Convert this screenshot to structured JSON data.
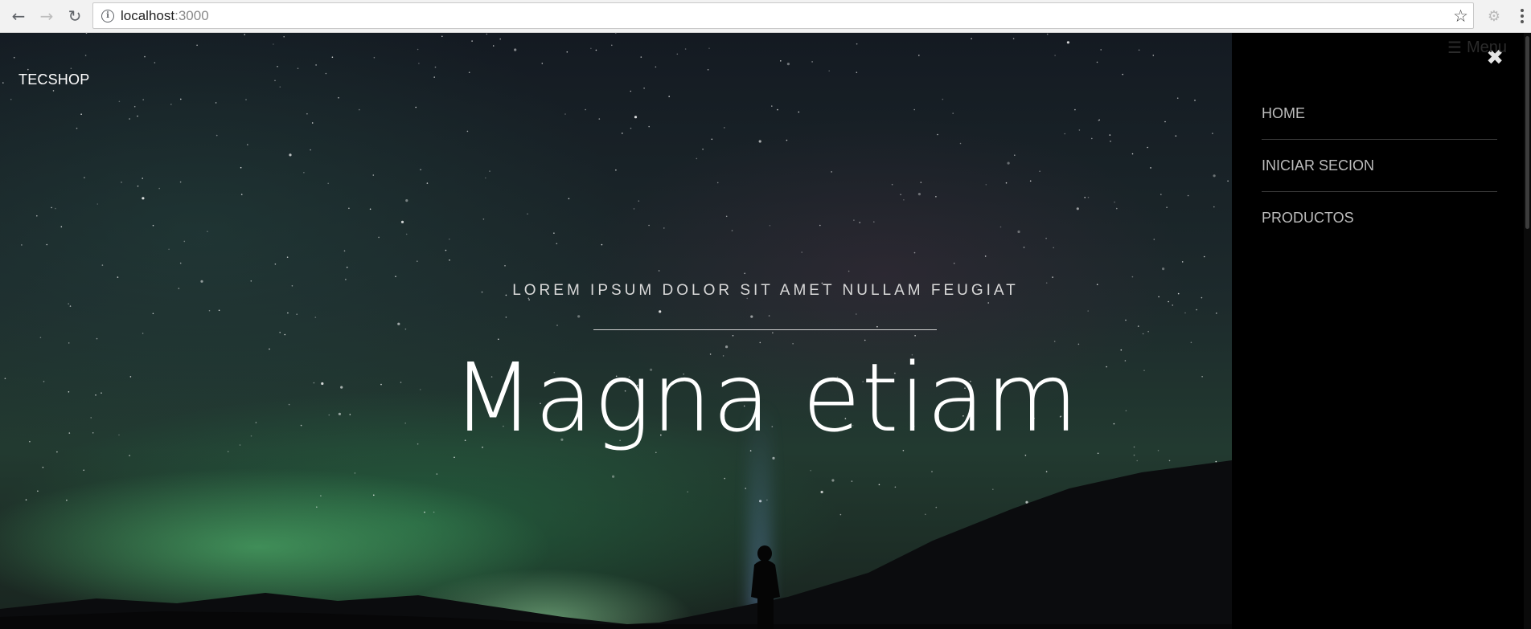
{
  "browser": {
    "url_host": "localhost",
    "url_port": ":3000"
  },
  "site": {
    "brand": "TECSHOP",
    "tagline": "LOREM IPSUM DOLOR SIT AMET NULLAM FEUGIAT",
    "headline": "Magna etiam",
    "menu_toggle_label": "Menu"
  },
  "side_menu": {
    "items": [
      {
        "label": "HOME"
      },
      {
        "label": "INICIAR SECION"
      },
      {
        "label": "PRODUCTOS"
      }
    ]
  },
  "icons": {
    "back": "back-arrow-icon",
    "forward": "forward-arrow-icon",
    "reload": "reload-icon",
    "info": "info-icon",
    "bookmark": "star-icon",
    "extension": "extension-icon",
    "browser_menu": "kebab-menu-icon",
    "close": "close-icon",
    "menu": "hamburger-icon"
  }
}
